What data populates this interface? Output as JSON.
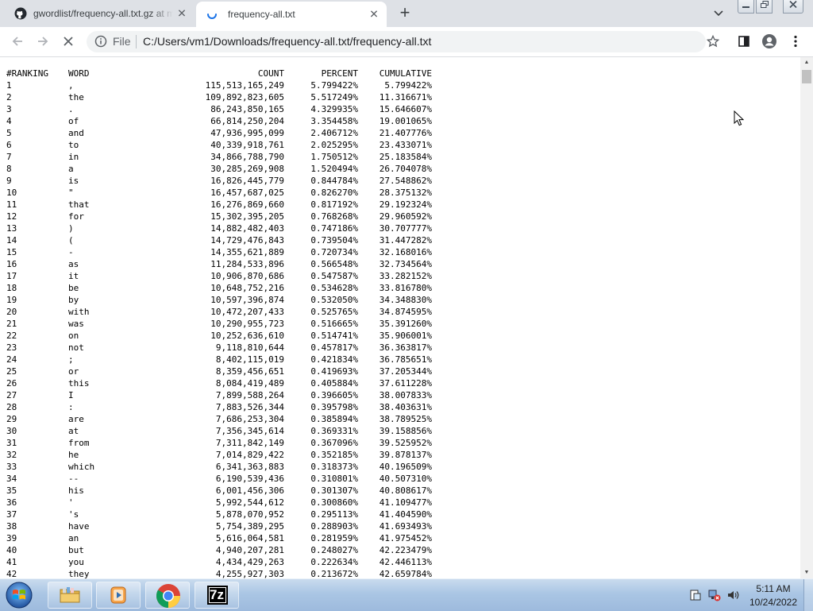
{
  "browser": {
    "tabs": [
      {
        "title": "gwordlist/frequency-all.txt.gz at m",
        "icon": "github-icon",
        "active": false
      },
      {
        "title": "frequency-all.txt",
        "icon": "loading-spinner-icon",
        "active": true
      }
    ],
    "new_tab_label": "+",
    "omnibox": {
      "chip": "File",
      "url": "C:/Users/vm1/Downloads/frequency-all.txt/frequency-all.txt"
    }
  },
  "document": {
    "headers": [
      "#RANKING",
      "WORD",
      "COUNT",
      "PERCENT",
      "CUMULATIVE"
    ],
    "rows": [
      [
        "1",
        ",",
        "115,513,165,249",
        "5.799422%",
        "5.799422%"
      ],
      [
        "2",
        "the",
        "109,892,823,605",
        "5.517249%",
        "11.316671%"
      ],
      [
        "3",
        ".",
        "86,243,850,165",
        "4.329935%",
        "15.646607%"
      ],
      [
        "4",
        "of",
        "66,814,250,204",
        "3.354458%",
        "19.001065%"
      ],
      [
        "5",
        "and",
        "47,936,995,099",
        "2.406712%",
        "21.407776%"
      ],
      [
        "6",
        "to",
        "40,339,918,761",
        "2.025295%",
        "23.433071%"
      ],
      [
        "7",
        "in",
        "34,866,788,790",
        "1.750512%",
        "25.183584%"
      ],
      [
        "8",
        "a",
        "30,285,269,908",
        "1.520494%",
        "26.704078%"
      ],
      [
        "9",
        "is",
        "16,826,445,779",
        "0.844784%",
        "27.548862%"
      ],
      [
        "10",
        "\"",
        "16,457,687,025",
        "0.826270%",
        "28.375132%"
      ],
      [
        "11",
        "that",
        "16,276,869,660",
        "0.817192%",
        "29.192324%"
      ],
      [
        "12",
        "for",
        "15,302,395,205",
        "0.768268%",
        "29.960592%"
      ],
      [
        "13",
        ")",
        "14,882,482,403",
        "0.747186%",
        "30.707777%"
      ],
      [
        "14",
        "(",
        "14,729,476,843",
        "0.739504%",
        "31.447282%"
      ],
      [
        "15",
        "-",
        "14,355,621,889",
        "0.720734%",
        "32.168016%"
      ],
      [
        "16",
        "as",
        "11,284,533,896",
        "0.566548%",
        "32.734564%"
      ],
      [
        "17",
        "it",
        "10,906,870,686",
        "0.547587%",
        "33.282152%"
      ],
      [
        "18",
        "be",
        "10,648,752,216",
        "0.534628%",
        "33.816780%"
      ],
      [
        "19",
        "by",
        "10,597,396,874",
        "0.532050%",
        "34.348830%"
      ],
      [
        "20",
        "with",
        "10,472,207,433",
        "0.525765%",
        "34.874595%"
      ],
      [
        "21",
        "was",
        "10,290,955,723",
        "0.516665%",
        "35.391260%"
      ],
      [
        "22",
        "on",
        "10,252,636,610",
        "0.514741%",
        "35.906001%"
      ],
      [
        "23",
        "not",
        "9,118,810,644",
        "0.457817%",
        "36.363817%"
      ],
      [
        "24",
        ";",
        "8,402,115,019",
        "0.421834%",
        "36.785651%"
      ],
      [
        "25",
        "or",
        "8,359,456,651",
        "0.419693%",
        "37.205344%"
      ],
      [
        "26",
        "this",
        "8,084,419,489",
        "0.405884%",
        "37.611228%"
      ],
      [
        "27",
        "I",
        "7,899,588,264",
        "0.396605%",
        "38.007833%"
      ],
      [
        "28",
        ":",
        "7,883,526,344",
        "0.395798%",
        "38.403631%"
      ],
      [
        "29",
        "are",
        "7,686,253,304",
        "0.385894%",
        "38.789525%"
      ],
      [
        "30",
        "at",
        "7,356,345,614",
        "0.369331%",
        "39.158856%"
      ],
      [
        "31",
        "from",
        "7,311,842,149",
        "0.367096%",
        "39.525952%"
      ],
      [
        "32",
        "he",
        "7,014,829,422",
        "0.352185%",
        "39.878137%"
      ],
      [
        "33",
        "which",
        "6,341,363,883",
        "0.318373%",
        "40.196509%"
      ],
      [
        "34",
        "--",
        "6,190,539,436",
        "0.310801%",
        "40.507310%"
      ],
      [
        "35",
        "his",
        "6,001,456,306",
        "0.301307%",
        "40.808617%"
      ],
      [
        "36",
        "'",
        "5,992,544,612",
        "0.300860%",
        "41.109477%"
      ],
      [
        "37",
        "'s",
        "5,878,070,952",
        "0.295113%",
        "41.404590%"
      ],
      [
        "38",
        "have",
        "5,754,389,295",
        "0.288903%",
        "41.693493%"
      ],
      [
        "39",
        "an",
        "5,616,064,581",
        "0.281959%",
        "41.975452%"
      ],
      [
        "40",
        "but",
        "4,940,207,281",
        "0.248027%",
        "42.223479%"
      ],
      [
        "41",
        "you",
        "4,434,429,263",
        "0.222634%",
        "42.446113%"
      ],
      [
        "42",
        "they",
        "4,255,927,303",
        "0.213672%",
        "42.659784%"
      ]
    ]
  },
  "taskbar": {
    "pinned": [
      {
        "name": "explorer",
        "icon": "folder-icon"
      },
      {
        "name": "media-player",
        "icon": "media-player-icon"
      },
      {
        "name": "chrome",
        "icon": "chrome-icon"
      },
      {
        "name": "7zip",
        "icon": "7zip-icon",
        "label": "7z"
      }
    ],
    "clock": {
      "time": "5:11 AM",
      "date": "10/24/2022"
    }
  },
  "colors": {
    "tabbar": "#dee1e6",
    "omnibox": "#f1f3f4",
    "taskbar": "#aac6e4"
  }
}
